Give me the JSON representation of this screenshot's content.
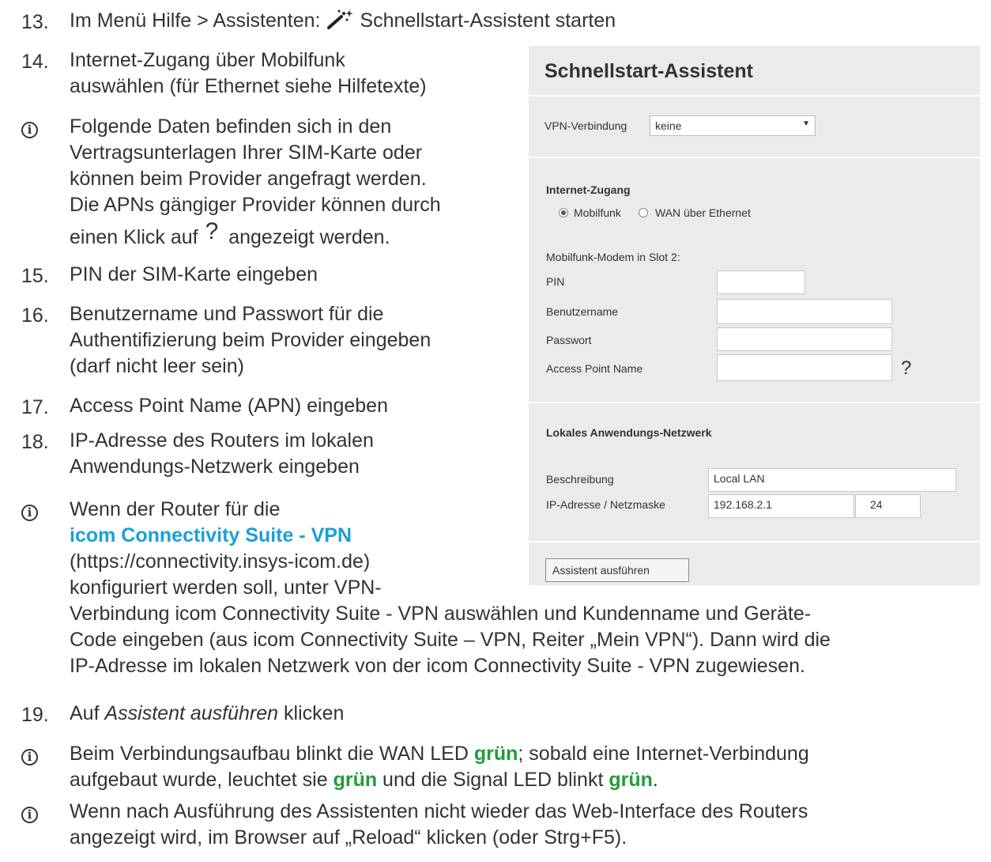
{
  "steps": {
    "s13": {
      "num": "13.",
      "before": "Im Menü Hilfe > Assistenten:",
      "after": " Schnellstart-Assistent starten"
    },
    "s14": {
      "num": "14.",
      "l1": "Internet-Zugang über Mobilfunk",
      "l2": "auswählen (für Ethernet siehe Hilfetexte)"
    },
    "i1": {
      "l1": "Folgende Daten befinden sich in den",
      "l2": "Vertragsunterlagen Ihrer SIM-Karte oder",
      "l3": "können beim Provider angefragt werden.",
      "l4": "Die APNs gängiger Provider können durch",
      "l5a": "einen Klick auf",
      "l5q": "?",
      "l5b": "angezeigt werden."
    },
    "s15": {
      "num": "15.",
      "l1": "PIN der SIM-Karte eingeben"
    },
    "s16": {
      "num": "16.",
      "l1": "Benutzername und Passwort für die",
      "l2": "Authentifizierung beim Provider eingeben",
      "l3": "(darf nicht leer sein)"
    },
    "s17": {
      "num": "17.",
      "l1": "Access Point Name (APN) eingeben"
    },
    "s18": {
      "num": "18.",
      "l1": "IP-Adresse des Routers im lokalen",
      "l2": "Anwendungs-Netzwerk eingeben"
    },
    "i2": {
      "l1": "Wenn der Router für die",
      "link": "icom Connectivity Suite - VPN",
      "l3": "(https://connectivity.insys-icom.de)",
      "l4": "konfiguriert werden soll, unter VPN-",
      "l5": "Verbindung icom Connectivity Suite - VPN auswählen und Kundenname und Geräte-",
      "l6": "Code eingeben (aus icom Connectivity Suite – VPN, Reiter „Mein VPN“). Dann wird die",
      "l7": "IP-Adresse im lokalen Netzwerk von der icom Connectivity Suite - VPN zugewiesen."
    },
    "s19": {
      "num": "19.",
      "a": "Auf ",
      "em": "Assistent ausführen",
      "b": " klicken"
    },
    "i3": {
      "a": "Beim Verbindungsaufbau blinkt die WAN LED ",
      "g1": "grün",
      "b": "; sobald eine Internet-Verbindung",
      "c": "aufgebaut wurde, leuchtet sie ",
      "g2": "grün",
      "d": " und die Signal LED blinkt ",
      "g3": "grün",
      "e": "."
    },
    "i4": {
      "l1": "Wenn nach Ausführung des Assistenten nicht wieder das Web-Interface des Routers",
      "l2": "angezeigt wird, im Browser auf „Reload“ klicken (oder Strg+F5)."
    }
  },
  "info_symbol": "i",
  "panel": {
    "title": "Schnellstart-Assistent",
    "vpn_label": "VPN-Verbindung",
    "vpn_value": "keine",
    "internet_heading": "Internet-Zugang",
    "radio_mobil": "Mobilfunk",
    "radio_wan": "WAN über Ethernet",
    "modem_label": "Mobilfunk-Modem in Slot 2:",
    "pin_label": "PIN",
    "user_label": "Benutzername",
    "pass_label": "Passwort",
    "apn_label": "Access Point Name",
    "apn_help": "?",
    "lan_heading": "Lokales Anwendungs-Netzwerk",
    "desc_label": "Beschreibung",
    "desc_value": "Local LAN",
    "ip_label": "IP-Adresse / Netzmaske",
    "ip_value": "192.168.2.1",
    "slash": "/",
    "mask_value": "24",
    "run_button": "Assistent ausführen"
  },
  "colors": {
    "green": "#1f9e3a",
    "link": "#1aa0d8",
    "panel_bg": "#ebebeb"
  }
}
